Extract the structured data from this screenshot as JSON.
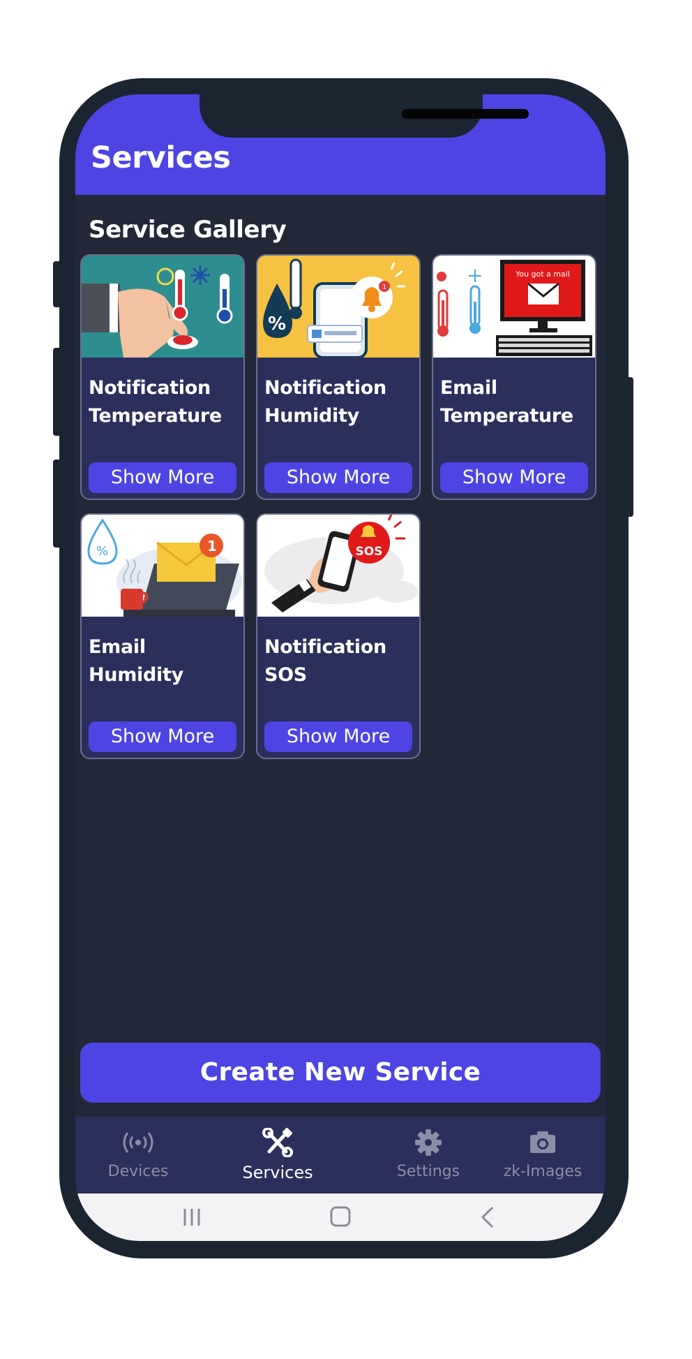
{
  "appbar": {
    "title": "Services"
  },
  "gallery": {
    "title": "Service Gallery",
    "cards": [
      {
        "title": "Notification Temperature",
        "button": "Show More",
        "image": "hand-pressing-button-thermometers"
      },
      {
        "title": "Notification Humidity",
        "button": "Show More",
        "image": "humidity-phone-bell"
      },
      {
        "title": "Email Temperature",
        "button": "Show More",
        "image": "thermometers-computer-mail",
        "image_text": "You got a mail"
      },
      {
        "title": "Email Humidity",
        "button": "Show More",
        "image": "humidity-laptop-mail"
      },
      {
        "title": "Notification SOS",
        "button": "Show More",
        "image": "hand-phone-sos",
        "image_text": "SOS"
      }
    ]
  },
  "create_button": "Create New Service",
  "nav": [
    {
      "label": "Devices",
      "icon": "broadcast-icon"
    },
    {
      "label": "Services",
      "icon": "tools-icon"
    },
    {
      "label": "Settings",
      "icon": "gear-icon"
    },
    {
      "label": "zk-Images",
      "icon": "camera-icon"
    }
  ],
  "nav_active": "Services",
  "colors": {
    "primary": "#4c45e3",
    "background": "#232838",
    "card": "#2b2f5c",
    "frame": "#1b2532"
  }
}
